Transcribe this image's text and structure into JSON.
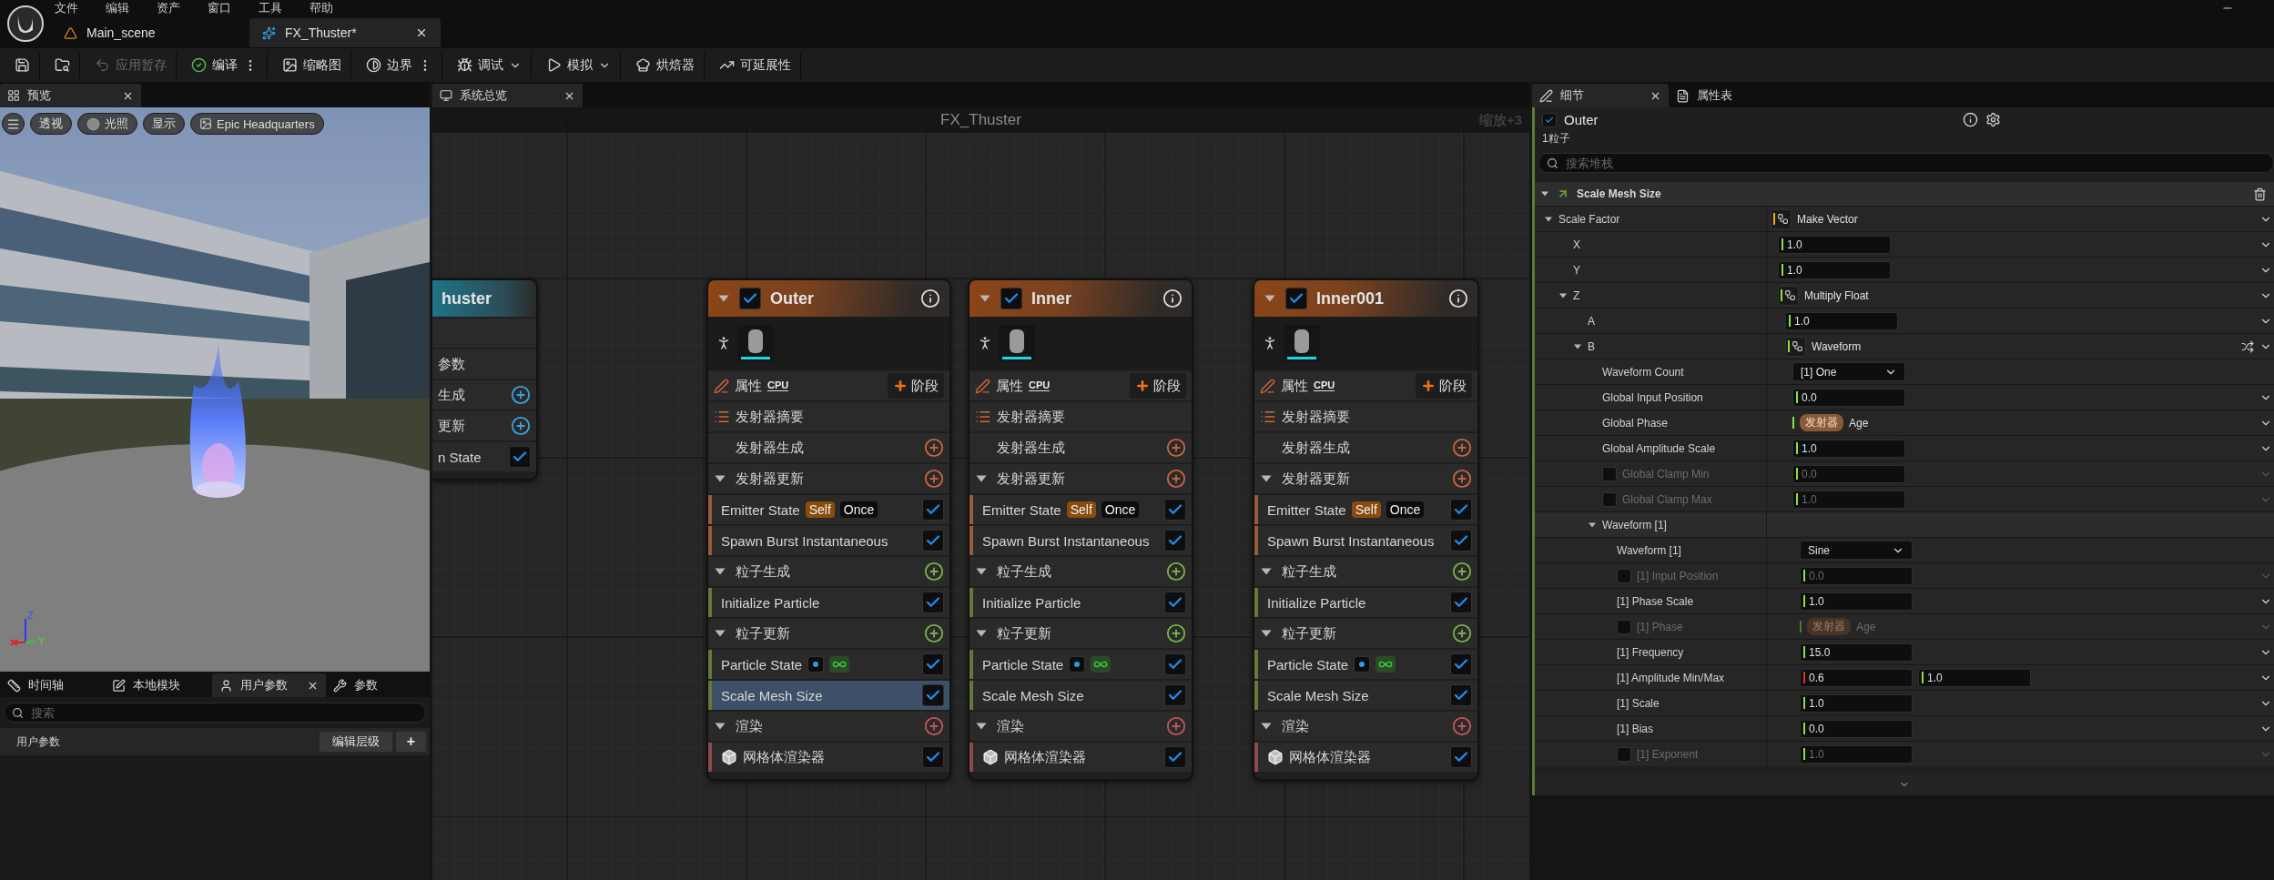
{
  "menu": [
    "文件",
    "编辑",
    "资产",
    "窗口",
    "工具",
    "帮助"
  ],
  "doc_tabs": [
    {
      "label": "Main_scene",
      "kind": "level",
      "selected": false
    },
    {
      "label": "FX_Thuster*",
      "kind": "niagara",
      "selected": true
    }
  ],
  "toolbar": [
    {
      "kind": "save",
      "disabled": false,
      "more": false,
      "dropdown": false
    },
    {
      "kind": "browse",
      "disabled": false,
      "more": false,
      "dropdown": false
    },
    {
      "kind": "apply",
      "label": "应用暂存",
      "disabled": true,
      "more": false,
      "dropdown": false
    },
    {
      "kind": "compile",
      "label": "编译",
      "disabled": false,
      "more": true,
      "dropdown": false
    },
    {
      "kind": "thumbnail",
      "label": "缩略图",
      "disabled": false,
      "more": false,
      "dropdown": false
    },
    {
      "kind": "bounds",
      "label": "边界",
      "disabled": false,
      "more": true,
      "dropdown": false
    },
    {
      "kind": "debug",
      "label": "调试",
      "disabled": false,
      "more": false,
      "dropdown": true
    },
    {
      "kind": "simulate",
      "label": "模拟",
      "disabled": false,
      "more": false,
      "dropdown": true
    },
    {
      "kind": "baker",
      "label": "烘焙器",
      "disabled": false,
      "more": false,
      "dropdown": false
    },
    {
      "kind": "scalability",
      "label": "可延展性",
      "disabled": false,
      "more": false,
      "dropdown": false
    }
  ],
  "left_panel": {
    "tab": "预览",
    "viewport": {
      "buttons": [
        {
          "kind": "menu"
        },
        {
          "kind": "text",
          "label": "透视"
        },
        {
          "kind": "lit",
          "label": "光照"
        },
        {
          "kind": "text",
          "label": "显示"
        },
        {
          "kind": "scene",
          "label": "Epic Headquarters"
        }
      ],
      "axis_labels": [
        "Z",
        "Y"
      ]
    },
    "bottom_tabs": [
      {
        "label": "时间轴",
        "kind": "timeline",
        "selected": false
      },
      {
        "label": "本地模块",
        "kind": "local",
        "selected": false
      },
      {
        "label": "用户参数",
        "kind": "user",
        "selected": true
      },
      {
        "label": "参数",
        "kind": "params",
        "selected": false
      }
    ],
    "search": {
      "placeholder": "搜索"
    },
    "user_params": {
      "label": "用户参数",
      "edit_button": "编辑层级",
      "add_button": "+"
    }
  },
  "graph": {
    "tab": "系统总览",
    "title": "FX_Thuster",
    "zoom": "缩放+3",
    "system_node": {
      "title": "huster",
      "rows": [
        {
          "kind": "blank"
        },
        {
          "kind": "label",
          "label": "参数"
        },
        {
          "kind": "add",
          "label": "生成"
        },
        {
          "kind": "add",
          "label": "更新"
        },
        {
          "kind": "check",
          "label": "n State",
          "checked": true
        }
      ]
    },
    "emitters": [
      {
        "name": "Outer",
        "enabled": true,
        "rows": [
          {
            "kind": "properties",
            "label": "属性",
            "badge": "CPU",
            "action": "阶段"
          },
          {
            "kind": "summary",
            "label": "发射器摘要"
          },
          {
            "kind": "section",
            "label": "发射器生成",
            "expanded": false,
            "color": "#c8633f"
          },
          {
            "kind": "section",
            "label": "发射器更新",
            "expanded": true,
            "color": "#c8633f"
          },
          {
            "kind": "module",
            "label": "Emitter State",
            "tags": [
              {
                "text": "Self",
                "kind": "scope"
              },
              {
                "text": "Once",
                "kind": "mode"
              }
            ],
            "checked": true,
            "selected": false,
            "color": "#9a5a3c"
          },
          {
            "kind": "module",
            "label": "Spawn Burst Instantaneous",
            "checked": true,
            "selected": false,
            "color": "#9a5a3c"
          },
          {
            "kind": "section",
            "label": "粒子生成",
            "expanded": true,
            "color": "#79b04a"
          },
          {
            "kind": "module",
            "label": "Initialize Particle",
            "checked": true,
            "selected": false,
            "color": "#66793c"
          },
          {
            "kind": "section",
            "label": "粒子更新",
            "expanded": true,
            "color": "#79b04a"
          },
          {
            "kind": "state-module",
            "label": "Particle State",
            "checked": true,
            "selected": false,
            "color": "#66793c"
          },
          {
            "kind": "module",
            "label": "Scale Mesh Size",
            "checked": true,
            "selected": true,
            "color": "#66793c"
          },
          {
            "kind": "section",
            "label": "渲染",
            "expanded": true,
            "color": "#c05656"
          },
          {
            "kind": "renderer",
            "label": "网格体渲染器",
            "checked": true,
            "selected": false,
            "color": "#8e4a4a"
          }
        ]
      },
      {
        "name": "Inner",
        "enabled": true,
        "rows": [
          {
            "kind": "properties",
            "label": "属性",
            "badge": "CPU",
            "action": "阶段"
          },
          {
            "kind": "summary",
            "label": "发射器摘要"
          },
          {
            "kind": "section",
            "label": "发射器生成",
            "expanded": false,
            "color": "#c8633f"
          },
          {
            "kind": "section",
            "label": "发射器更新",
            "expanded": true,
            "color": "#c8633f"
          },
          {
            "kind": "module",
            "label": "Emitter State",
            "tags": [
              {
                "text": "Self",
                "kind": "scope"
              },
              {
                "text": "Once",
                "kind": "mode"
              }
            ],
            "checked": true,
            "selected": false,
            "color": "#9a5a3c"
          },
          {
            "kind": "module",
            "label": "Spawn Burst Instantaneous",
            "checked": true,
            "selected": false,
            "color": "#9a5a3c"
          },
          {
            "kind": "section",
            "label": "粒子生成",
            "expanded": true,
            "color": "#79b04a"
          },
          {
            "kind": "module",
            "label": "Initialize Particle",
            "checked": true,
            "selected": false,
            "color": "#66793c"
          },
          {
            "kind": "section",
            "label": "粒子更新",
            "expanded": true,
            "color": "#79b04a"
          },
          {
            "kind": "state-module",
            "label": "Particle State",
            "checked": true,
            "selected": false,
            "color": "#66793c"
          },
          {
            "kind": "module",
            "label": "Scale Mesh Size",
            "checked": true,
            "selected": false,
            "color": "#66793c"
          },
          {
            "kind": "section",
            "label": "渲染",
            "expanded": true,
            "color": "#c05656"
          },
          {
            "kind": "renderer",
            "label": "网格体渲染器",
            "checked": true,
            "selected": false,
            "color": "#8e4a4a"
          }
        ]
      },
      {
        "name": "Inner001",
        "enabled": true,
        "rows": [
          {
            "kind": "properties",
            "label": "属性",
            "badge": "CPU",
            "action": "阶段"
          },
          {
            "kind": "summary",
            "label": "发射器摘要"
          },
          {
            "kind": "section",
            "label": "发射器生成",
            "expanded": false,
            "color": "#c8633f"
          },
          {
            "kind": "section",
            "label": "发射器更新",
            "expanded": true,
            "color": "#c8633f"
          },
          {
            "kind": "module",
            "label": "Emitter State",
            "tags": [
              {
                "text": "Self",
                "kind": "scope"
              },
              {
                "text": "Once",
                "kind": "mode"
              }
            ],
            "checked": true,
            "selected": false,
            "color": "#9a5a3c"
          },
          {
            "kind": "module",
            "label": "Spawn Burst Instantaneous",
            "checked": true,
            "selected": false,
            "color": "#9a5a3c"
          },
          {
            "kind": "section",
            "label": "粒子生成",
            "expanded": true,
            "color": "#79b04a"
          },
          {
            "kind": "module",
            "label": "Initialize Particle",
            "checked": true,
            "selected": false,
            "color": "#66793c"
          },
          {
            "kind": "section",
            "label": "粒子更新",
            "expanded": true,
            "color": "#79b04a"
          },
          {
            "kind": "state-module",
            "label": "Particle State",
            "checked": true,
            "selected": false,
            "color": "#66793c"
          },
          {
            "kind": "module",
            "label": "Scale Mesh Size",
            "checked": true,
            "selected": false,
            "color": "#66793c"
          },
          {
            "kind": "section",
            "label": "渲染",
            "expanded": true,
            "color": "#c05656"
          },
          {
            "kind": "renderer",
            "label": "网格体渲染器",
            "checked": true,
            "selected": false,
            "color": "#8e4a4a"
          }
        ]
      }
    ]
  },
  "details": {
    "tabs": [
      {
        "label": "细节",
        "kind": "details",
        "selected": true
      },
      {
        "label": "属性表",
        "kind": "sheet",
        "selected": false
      }
    ],
    "emitter": {
      "name": "Outer",
      "enabled": true
    },
    "count": "1粒子",
    "search": {
      "placeholder": "搜索堆栈"
    },
    "module": {
      "title": "Scale Mesh Size"
    },
    "params": [
      {
        "label": "Scale Factor",
        "kind": "dynamic",
        "value": "Make Vector",
        "color": "#f0b400",
        "expanded": true,
        "children": [
          {
            "label": "X",
            "kind": "number",
            "values": [
              {
                "text": "1.0",
                "color": "#8fe03a"
              }
            ]
          },
          {
            "label": "Y",
            "kind": "number",
            "values": [
              {
                "text": "1.0",
                "color": "#8fe03a"
              }
            ]
          },
          {
            "label": "Z",
            "kind": "dynamic",
            "value": "Multiply Float",
            "color": "#8fe03a",
            "expanded": true,
            "children": [
              {
                "label": "A",
                "kind": "number",
                "values": [
                  {
                    "text": "1.0",
                    "color": "#8fe03a"
                  }
                ]
              },
              {
                "label": "B",
                "kind": "dynamic",
                "value": "Waveform",
                "color": "#8fe03a",
                "expanded": true,
                "shuffle": true,
                "children": [
                  {
                    "label": "Waveform Count",
                    "kind": "enum",
                    "value": "[1] One"
                  },
                  {
                    "label": "Global Input Position",
                    "kind": "number",
                    "values": [
                      {
                        "text": "0.0",
                        "color": "#8fe03a"
                      }
                    ]
                  },
                  {
                    "label": "Global Phase",
                    "kind": "binding",
                    "tag": "发射器",
                    "value": "Age"
                  },
                  {
                    "label": "Global Amplitude Scale",
                    "kind": "number",
                    "values": [
                      {
                        "text": "1.0",
                        "color": "#8fe03a"
                      }
                    ]
                  },
                  {
                    "label": "Global Clamp Min",
                    "kind": "number",
                    "checked": false,
                    "values": [
                      {
                        "text": "0.0",
                        "color": "#8fe03a"
                      }
                    ]
                  },
                  {
                    "label": "Global Clamp Max",
                    "kind": "number",
                    "checked": false,
                    "values": [
                      {
                        "text": "1.0",
                        "color": "#8fe03a"
                      }
                    ]
                  },
                  {
                    "label": "Waveform [1]",
                    "kind": "group",
                    "expanded": true,
                    "children": [
                      {
                        "label": "Waveform [1]",
                        "kind": "enum",
                        "value": "Sine"
                      },
                      {
                        "label": "[1] Input Position",
                        "kind": "number",
                        "checked": false,
                        "values": [
                          {
                            "text": "0.0",
                            "color": "#8fe03a"
                          }
                        ]
                      },
                      {
                        "label": "[1] Phase Scale",
                        "kind": "number",
                        "values": [
                          {
                            "text": "1.0",
                            "color": "#8fe03a"
                          }
                        ]
                      },
                      {
                        "label": "[1] Phase",
                        "kind": "binding",
                        "checked": false,
                        "tag": "发射器",
                        "value": "Age"
                      },
                      {
                        "label": "[1] Frequency",
                        "kind": "number",
                        "values": [
                          {
                            "text": "15.0",
                            "color": "#8fe03a"
                          }
                        ]
                      },
                      {
                        "label": "[1] Amplitude Min/Max",
                        "kind": "number",
                        "values": [
                          {
                            "text": "0.6",
                            "color": "#e0301e"
                          },
                          {
                            "text": "1.0",
                            "color": "#8fe03a"
                          }
                        ]
                      },
                      {
                        "label": "[1] Scale",
                        "kind": "number",
                        "values": [
                          {
                            "text": "1.0",
                            "color": "#8fe03a"
                          }
                        ]
                      },
                      {
                        "label": "[1] Bias",
                        "kind": "number",
                        "values": [
                          {
                            "text": "0.0",
                            "color": "#8fe03a"
                          }
                        ]
                      },
                      {
                        "label": "[1] Exponent",
                        "kind": "number",
                        "checked": false,
                        "values": [
                          {
                            "text": "1.0",
                            "color": "#8fe03a"
                          }
                        ]
                      }
                    ]
                  }
                ]
              }
            ]
          }
        ]
      }
    ]
  }
}
